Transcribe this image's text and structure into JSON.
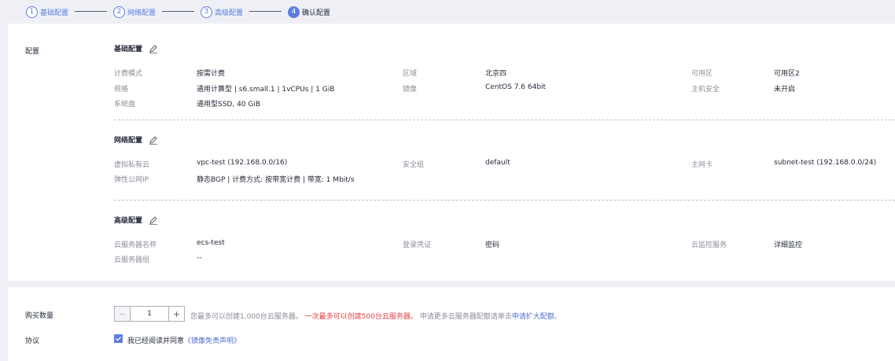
{
  "steps": [
    {
      "num": "1",
      "label": "基础配置"
    },
    {
      "num": "2",
      "label": "网络配置"
    },
    {
      "num": "3",
      "label": "高级配置"
    },
    {
      "num": "4",
      "label": "确认配置"
    }
  ],
  "config": {
    "section_label": "配置",
    "basic": {
      "title": "基础配置",
      "rows": [
        {
          "k1": "计费模式",
          "v1": "按需计费",
          "k2": "区域",
          "v2": "北京四",
          "k3": "可用区",
          "v3": "可用区2"
        },
        {
          "k1": "规格",
          "v1": "通用计算型 | s6.small.1 | 1vCPUs | 1 GiB",
          "k2": "镜像",
          "v2": "CentOS 7.6 64bit",
          "k3": "主机安全",
          "v3": "未开启"
        },
        {
          "k1": "系统盘",
          "v1": "通用型SSD, 40 GiB"
        }
      ]
    },
    "network": {
      "title": "网络配置",
      "rows": [
        {
          "k1": "虚拟私有云",
          "v1": "vpc-test (192.168.0.0/16)",
          "k2": "安全组",
          "v2": "default",
          "k3": "主网卡",
          "v3": "subnet-test (192.168.0.0/24)"
        },
        {
          "k1": "弹性公网IP",
          "v1": "静态BGP | 计费方式: 按带宽计费 | 带宽: 1 Mbit/s"
        }
      ]
    },
    "advanced": {
      "title": "高级配置",
      "rows": [
        {
          "k1": "云服务器名称",
          "v1": "ecs-test",
          "k2": "登录凭证",
          "v2": "密码",
          "k3": "云监控服务",
          "v3": "详细监控"
        },
        {
          "k1": "云服务器组",
          "v1": "--"
        }
      ]
    }
  },
  "purchase": {
    "qty_label": "购买数量",
    "qty_value": "1",
    "hint_normal": "您最多可以创建1,000台云服务器。",
    "hint_red": "一次最多可以创建500台云服务器。",
    "hint_more": "申请更多云服务器配额请单击",
    "hint_link": "申请扩大配额",
    "hint_end": "。",
    "agreement_label": "协议",
    "agreement_text": "我已经阅读并同意",
    "agreement_link": "《镜像免责声明》"
  },
  "colors": {
    "accent": "#5e7ce0",
    "warning": "#e63e45",
    "link": "#526ecc"
  }
}
